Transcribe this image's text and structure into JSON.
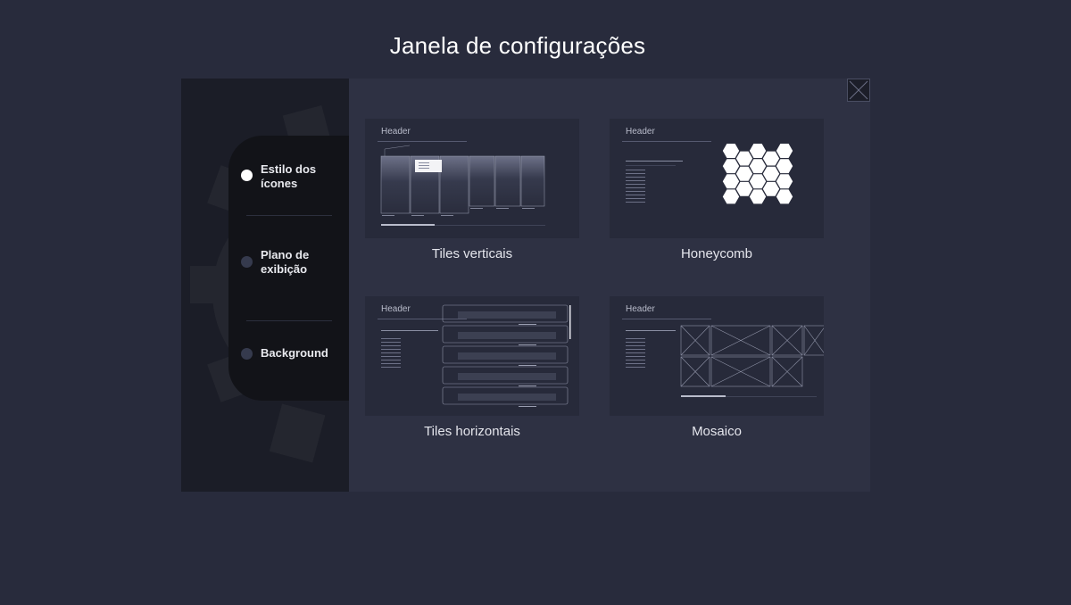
{
  "page": {
    "title": "Janela de configurações"
  },
  "sidebar": {
    "items": [
      {
        "label": "Estilo dos ícones",
        "active": true
      },
      {
        "label": "Plano de exibição",
        "active": false
      },
      {
        "label": "Background",
        "active": false
      }
    ]
  },
  "close": {
    "icon": "close-x-icon"
  },
  "options": [
    {
      "header": "Header",
      "label": "Tiles verticais"
    },
    {
      "header": "Header",
      "label": "Honeycomb"
    },
    {
      "header": "Header",
      "label": "Tiles horizontais"
    },
    {
      "header": "Header",
      "label": "Mosaico"
    }
  ],
  "colors": {
    "background": "#282b3c",
    "window": "#2e3143",
    "sidebar": "#1b1d27",
    "menu_panel": "#121318",
    "active_dot": "#ffffff",
    "inactive_dot": "#353a4d"
  }
}
